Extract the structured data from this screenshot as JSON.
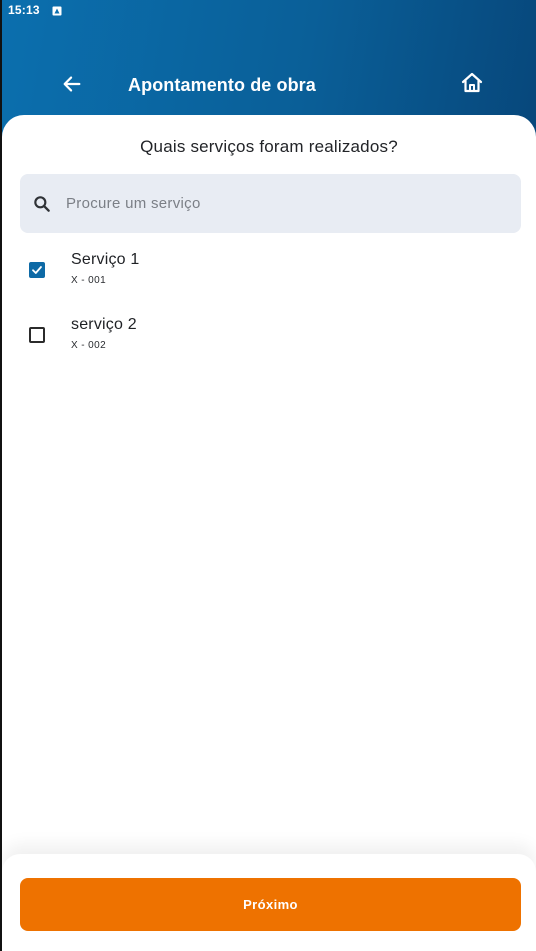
{
  "status_bar": {
    "time": "15:13",
    "notification_icon": "notification-app-icon"
  },
  "header": {
    "title": "Apontamento de obra",
    "back_icon": "arrow-left-icon",
    "home_icon": "home-icon"
  },
  "main": {
    "question": "Quais serviços foram realizados?",
    "search": {
      "placeholder": "Procure um serviço",
      "value": ""
    },
    "services": [
      {
        "name": "Serviço 1",
        "code": "X - 001",
        "checked": true
      },
      {
        "name": "serviço 2",
        "code": "X - 002",
        "checked": false
      }
    ]
  },
  "footer": {
    "next_label": "Próximo"
  },
  "colors": {
    "header_gradient_start": "#0b6fae",
    "header_gradient_end": "#05396a",
    "checkbox_accent": "#0e6aa6",
    "primary_button": "#ee7200",
    "search_background": "#e8ecf3"
  }
}
